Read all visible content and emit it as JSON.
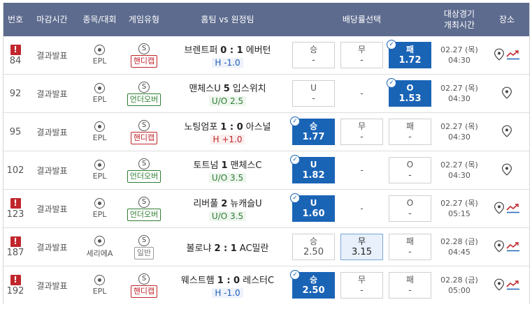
{
  "headers": {
    "no": "번호",
    "deadline": "마감시간",
    "sport": "종목/대회",
    "game_type": "게임유형",
    "match": "홈팀 vs 원정팀",
    "odds": "배당률선택",
    "time_line1": "대상경기",
    "time_line2": "개최시간",
    "place": "장소"
  },
  "rows": [
    {
      "no": "84",
      "alert": "!",
      "deadline": "결과발표",
      "league": "EPL",
      "sport_code": "S",
      "type": "핸디캡",
      "type_kind": "hc",
      "home": "브렌트퍼",
      "score": "0 : 1",
      "away": "에버턴",
      "line": "H -1.0",
      "line_kind": "blue",
      "odds": [
        {
          "label": "승",
          "value": "-",
          "style": "box",
          "check": false
        },
        {
          "label": "무",
          "value": "-",
          "style": "box",
          "check": false
        },
        {
          "label": "패",
          "value": "1.72",
          "style": "sel",
          "check": true
        }
      ],
      "date": "02.27 (목)",
      "time": "04:30",
      "trend": true
    },
    {
      "no": "92",
      "alert": "",
      "deadline": "결과발표",
      "league": "EPL",
      "sport_code": "S",
      "type": "언더오버",
      "type_kind": "ou",
      "home": "맨체스U",
      "score": "5",
      "away": "입스위치",
      "line": "U/O 2.5",
      "line_kind": "green",
      "odds": [
        {
          "label": "U",
          "value": "-",
          "style": "box",
          "check": false
        },
        {
          "label": "-",
          "value": "",
          "style": "dash",
          "check": false
        },
        {
          "label": "O",
          "value": "1.53",
          "style": "sel",
          "check": true
        }
      ],
      "date": "02.27 (목)",
      "time": "04:30",
      "trend": false
    },
    {
      "no": "95",
      "alert": "",
      "deadline": "결과발표",
      "league": "EPL",
      "sport_code": "S",
      "type": "핸디캡",
      "type_kind": "hc",
      "home": "노팅엄포",
      "score": "1 : 0",
      "away": "아스널",
      "line": "H +1.0",
      "line_kind": "red",
      "odds": [
        {
          "label": "승",
          "value": "1.77",
          "style": "sel",
          "check": true
        },
        {
          "label": "무",
          "value": "-",
          "style": "box",
          "check": false
        },
        {
          "label": "패",
          "value": "-",
          "style": "box",
          "check": false
        }
      ],
      "date": "02.27 (목)",
      "time": "04:30",
      "trend": false
    },
    {
      "no": "102",
      "alert": "",
      "deadline": "결과발표",
      "league": "EPL",
      "sport_code": "S",
      "type": "언더오버",
      "type_kind": "ou",
      "home": "토트넘",
      "score": "1",
      "away": "맨체스C",
      "line": "U/O 3.5",
      "line_kind": "green",
      "odds": [
        {
          "label": "U",
          "value": "1.82",
          "style": "sel",
          "check": true
        },
        {
          "label": "-",
          "value": "",
          "style": "dash",
          "check": false
        },
        {
          "label": "O",
          "value": "-",
          "style": "box",
          "check": false
        }
      ],
      "date": "02.27 (목)",
      "time": "04:30",
      "trend": false
    },
    {
      "no": "123",
      "alert": "!",
      "deadline": "결과발표",
      "league": "EPL",
      "sport_code": "S",
      "type": "언더오버",
      "type_kind": "ou",
      "home": "리버풀",
      "score": "2",
      "away": "뉴캐슬U",
      "line": "U/O 3.5",
      "line_kind": "green",
      "odds": [
        {
          "label": "U",
          "value": "1.60",
          "style": "sel",
          "check": true
        },
        {
          "label": "-",
          "value": "",
          "style": "dash",
          "check": false
        },
        {
          "label": "O",
          "value": "-",
          "style": "box",
          "check": false
        }
      ],
      "date": "02.27 (목)",
      "time": "05:15",
      "trend": true
    },
    {
      "no": "187",
      "alert": "!",
      "deadline": "결과발표",
      "league": "세리에A",
      "sport_code": "S",
      "type": "일반",
      "type_kind": "nm",
      "home": "볼로냐",
      "score": "2 : 1",
      "away": "AC밀란",
      "line": "",
      "line_kind": "",
      "odds": [
        {
          "label": "승",
          "value": "2.50",
          "style": "box",
          "check": false
        },
        {
          "label": "무",
          "value": "3.15",
          "style": "lt",
          "check": false
        },
        {
          "label": "패",
          "value": "-",
          "style": "box",
          "check": false
        }
      ],
      "date": "02.28 (금)",
      "time": "04:45",
      "trend": true
    },
    {
      "no": "192",
      "alert": "!",
      "deadline": "결과발표",
      "league": "EPL",
      "sport_code": "S",
      "type": "핸디캡",
      "type_kind": "hc",
      "home": "웨스트햄",
      "score": "1 : 0",
      "away": "레스터C",
      "line": "H -1.0",
      "line_kind": "blue",
      "odds": [
        {
          "label": "승",
          "value": "2.50",
          "style": "sel",
          "check": true
        },
        {
          "label": "무",
          "value": "-",
          "style": "box",
          "check": false
        },
        {
          "label": "패",
          "value": "-",
          "style": "box",
          "check": false
        }
      ],
      "date": "02.28 (금)",
      "time": "05:00",
      "trend": true
    }
  ],
  "colors": {
    "header_bg": "#5d6b8e",
    "selected_odds": "#1a64b6",
    "alert": "#c0262c",
    "handicap": "#c0262c",
    "underover": "#2e7d32"
  }
}
